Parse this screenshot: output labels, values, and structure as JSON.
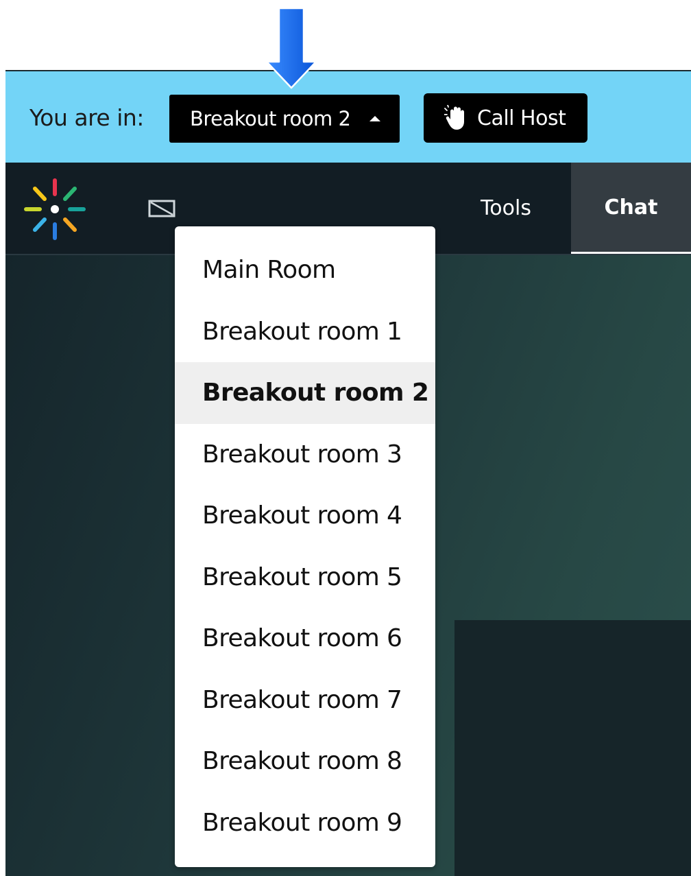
{
  "room_bar": {
    "you_are_in_label": "You are in:",
    "current_room": "Breakout room 2",
    "call_host_label": "Call Host"
  },
  "nav": {
    "tabs": [
      {
        "label": "Tools",
        "active": false
      },
      {
        "label": "Chat",
        "active": true
      }
    ]
  },
  "room_dropdown": {
    "options": [
      {
        "label": "Main Room",
        "selected": false
      },
      {
        "label": "Breakout room 1",
        "selected": false
      },
      {
        "label": "Breakout room 2",
        "selected": true
      },
      {
        "label": "Breakout room 3",
        "selected": false
      },
      {
        "label": "Breakout room 4",
        "selected": false
      },
      {
        "label": "Breakout room 5",
        "selected": false
      },
      {
        "label": "Breakout room 6",
        "selected": false
      },
      {
        "label": "Breakout room 7",
        "selected": false
      },
      {
        "label": "Breakout room 8",
        "selected": false
      },
      {
        "label": "Breakout room 9",
        "selected": false
      }
    ]
  },
  "icons": {
    "annotation_arrow": "down-arrow-icon",
    "call_host": "raised-hand-icon",
    "dropdown_caret": "caret-up-icon",
    "logo": "sparkle-logo-icon"
  },
  "colors": {
    "room_bar": "#73d4f7",
    "nav_bar": "#121d24",
    "annotation_arrow": "#1f6ff0",
    "button_bg": "#000000"
  }
}
